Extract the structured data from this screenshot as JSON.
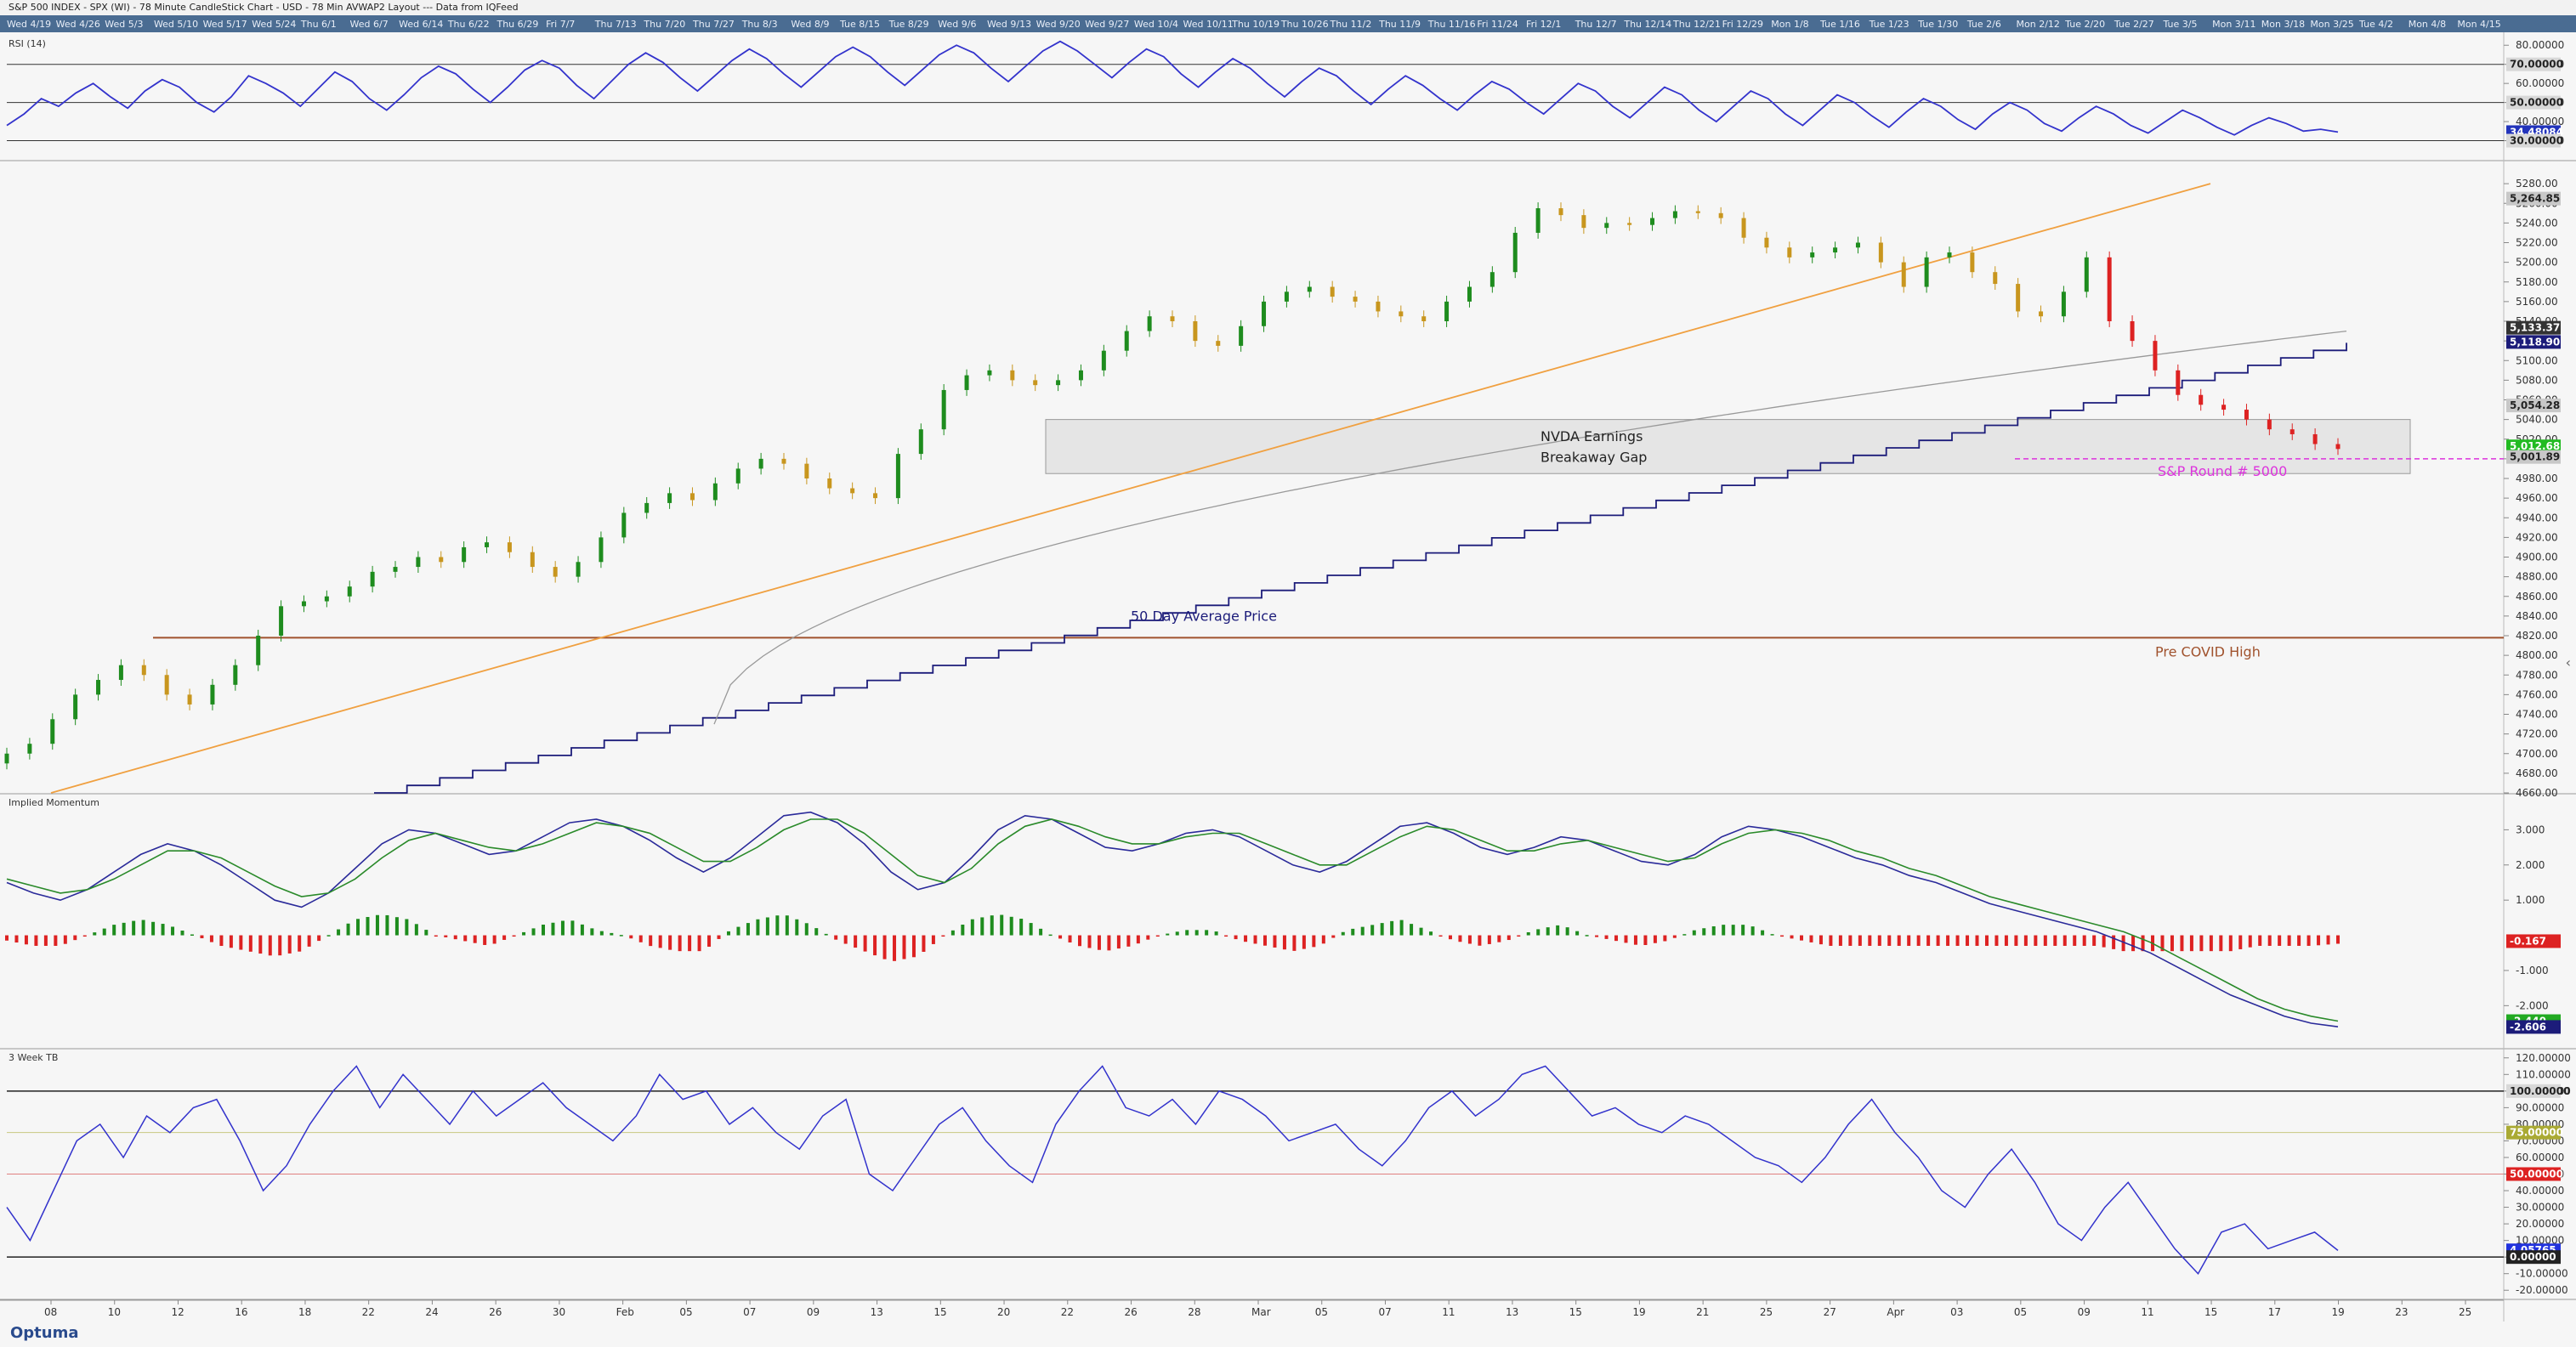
{
  "window": {
    "title": "S&P 500 INDEX - SPX (WI) - 78 Minute CandleStick Chart - USD - 78 Min AVWAP2 Layout --- Data from IQFeed"
  },
  "date_strip": [
    "Wed 4/19",
    "Wed 4/26",
    "Wed 5/3",
    "Wed 5/10",
    "Wed 5/17",
    "Wed 5/24",
    "Thu 6/1",
    "Wed 6/7",
    "Wed 6/14",
    "Thu 6/22",
    "Thu 6/29",
    "Fri 7/7",
    "Thu 7/13",
    "Thu 7/20",
    "Thu 7/27",
    "Thu 8/3",
    "Wed 8/9",
    "Tue 8/15",
    "Tue 8/29",
    "Wed 9/6",
    "Wed 9/13",
    "Wed 9/20",
    "Wed 9/27",
    "Wed 10/4",
    "Wed 10/11",
    "Thu 10/19",
    "Thu 10/26",
    "Thu 11/2",
    "Thu 11/9",
    "Thu 11/16",
    "Fri 11/24",
    "Fri 12/1",
    "Thu 12/7",
    "Thu 12/14",
    "Thu 12/21",
    "Fri 12/29",
    "Mon 1/8",
    "Tue 1/16",
    "Tue 1/23",
    "Tue 1/30",
    "Tue 2/6",
    "Mon 2/12",
    "Tue 2/20",
    "Tue 2/27",
    "Tue 3/5",
    "Mon 3/11",
    "Mon 3/18",
    "Mon 3/25",
    "Tue 4/2",
    "Mon 4/8",
    "Mon 4/15"
  ],
  "footer": {
    "logo": "Optuma"
  },
  "colors": {
    "up_candle": "#1e8c1e",
    "down_candle": "#c8961e",
    "red_candle": "#dd2222",
    "rsi_line": "#3333cc",
    "vwap_line": "#1c1c7a",
    "trendline": "#f0a040",
    "pre_covid_line": "#a0522d",
    "round_5000": "#dd33dd"
  },
  "chart_data": [
    {
      "type": "line",
      "name_label": "RSI (14)",
      "ylim": [
        20,
        85
      ],
      "y_ticks": [
        30,
        40,
        50,
        60,
        70,
        80
      ],
      "y_tick_labels": [
        "30.00000",
        "40.00000",
        "50.00000",
        "60.00000",
        "70.00000",
        "80.00000"
      ],
      "reference_lines": [
        30,
        50,
        70
      ],
      "badges": [
        {
          "label": "70.00000",
          "value": 70,
          "bg": "#d8d8d8",
          "fg": "#222"
        },
        {
          "label": "50.00000",
          "value": 50,
          "bg": "#d8d8d8",
          "fg": "#222"
        },
        {
          "label": "34.48084",
          "value": 34.48,
          "bg": "#2233bb",
          "fg": "#fff"
        },
        {
          "label": "30.00000",
          "value": 30,
          "bg": "#d8d8d8",
          "fg": "#222"
        }
      ],
      "values": [
        38,
        44,
        52,
        48,
        55,
        60,
        53,
        47,
        56,
        62,
        58,
        50,
        45,
        53,
        64,
        60,
        55,
        48,
        57,
        66,
        61,
        52,
        46,
        54,
        63,
        69,
        65,
        57,
        50,
        58,
        67,
        72,
        68,
        59,
        52,
        61,
        70,
        76,
        71,
        63,
        56,
        64,
        72,
        78,
        73,
        65,
        58,
        66,
        74,
        79,
        74,
        66,
        59,
        67,
        75,
        80,
        76,
        68,
        61,
        69,
        77,
        82,
        77,
        70,
        63,
        71,
        78,
        74,
        65,
        58,
        66,
        73,
        68,
        60,
        53,
        61,
        68,
        64,
        56,
        49,
        57,
        64,
        59,
        52,
        46,
        54,
        61,
        57,
        50,
        44,
        52,
        60,
        56,
        48,
        42,
        50,
        58,
        54,
        46,
        40,
        48,
        56,
        52,
        44,
        38,
        46,
        54,
        50,
        43,
        37,
        45,
        52,
        48,
        41,
        36,
        44,
        50,
        46,
        39,
        35,
        42,
        48,
        44,
        38,
        34,
        40,
        46,
        42,
        37,
        33,
        38,
        42,
        39,
        35,
        36,
        34.5
      ]
    },
    {
      "type": "candlestick",
      "ylim": [
        4660,
        5300
      ],
      "y_ticks": [
        4660,
        4680,
        4700,
        4720,
        4740,
        4760,
        4780,
        4800,
        4820,
        4840,
        4860,
        4880,
        4900,
        4920,
        4940,
        4960,
        4980,
        5000,
        5020,
        5040,
        5060,
        5080,
        5100,
        5120,
        5140,
        5160,
        5180,
        5200,
        5220,
        5240,
        5260,
        5280
      ],
      "x_labels": [
        "08",
        "10",
        "12",
        "16",
        "18",
        "22",
        "24",
        "26",
        "30",
        "Feb",
        "05",
        "07",
        "09",
        "13",
        "15",
        "20",
        "22",
        "26",
        "28",
        "Mar",
        "05",
        "07",
        "11",
        "13",
        "15",
        "19",
        "21",
        "25",
        "27",
        "Apr",
        "03",
        "05",
        "09",
        "11",
        "15",
        "17",
        "19",
        "23",
        "25"
      ],
      "close": [
        4700,
        4710,
        4735,
        4760,
        4775,
        4790,
        4780,
        4760,
        4750,
        4770,
        4790,
        4820,
        4850,
        4855,
        4860,
        4870,
        4885,
        4890,
        4900,
        4895,
        4910,
        4915,
        4905,
        4890,
        4880,
        4895,
        4920,
        4945,
        4955,
        4965,
        4958,
        4975,
        4990,
        5000,
        4995,
        4980,
        4970,
        4965,
        4960,
        5005,
        5030,
        5070,
        5085,
        5090,
        5080,
        5075,
        5080,
        5090,
        5110,
        5130,
        5145,
        5140,
        5120,
        5115,
        5135,
        5160,
        5170,
        5175,
        5165,
        5160,
        5150,
        5145,
        5140,
        5160,
        5175,
        5190,
        5230,
        5255,
        5248,
        5235,
        5240,
        5238,
        5245,
        5252,
        5250,
        5245,
        5225,
        5215,
        5205,
        5210,
        5215,
        5220,
        5200,
        5175,
        5205,
        5210,
        5190,
        5178,
        5150,
        5145,
        5170,
        5205,
        5140,
        5120,
        5090,
        5065,
        5055,
        5050,
        5040,
        5030,
        5025,
        5015,
        5010
      ],
      "annotations": [
        {
          "text": "NVDA Earnings",
          "line": 1
        },
        {
          "text": "Breakaway Gap",
          "line": 2
        },
        {
          "text": "S&P Round # 5000"
        },
        {
          "text": "50 Day Average Price"
        },
        {
          "text": "Pre COVID High"
        }
      ],
      "levels": {
        "pre_covid_high": 4818,
        "round_5000": 5000,
        "gap_top": 5040,
        "gap_bottom": 4985
      },
      "badges": [
        {
          "label": "5,264.85",
          "value": 5264.85,
          "bg": "#c8c8c8",
          "fg": "#222"
        },
        {
          "label": "5,133.37",
          "value": 5133.37,
          "bg": "#333",
          "fg": "#fff"
        },
        {
          "label": "5,118.90",
          "value": 5118.9,
          "bg": "#1c1c7a",
          "fg": "#fff"
        },
        {
          "label": "5,054.28",
          "value": 5054.28,
          "bg": "#c8c8c8",
          "fg": "#222"
        },
        {
          "label": "5,012.68",
          "value": 5012.68,
          "bg": "#22bb22",
          "fg": "#fff"
        },
        {
          "label": "5,001.89",
          "value": 5001.89,
          "bg": "#c8c8c8",
          "fg": "#222"
        }
      ]
    },
    {
      "type": "line",
      "name_label": "Implied Momentum",
      "ylim": [
        -3.2,
        4.0
      ],
      "y_ticks": [
        3.0,
        2.0,
        1.0,
        -1.0,
        -2.0
      ],
      "y_tick_labels": [
        "3.000",
        "2.000",
        "1.000",
        "-1.000",
        "-2.000"
      ],
      "badges": [
        {
          "label": "-0.167",
          "value": -0.167,
          "bg": "#dd2222",
          "fg": "#fff"
        },
        {
          "label": "-2.440",
          "value": -2.44,
          "bg": "#22aa22",
          "fg": "#fff"
        },
        {
          "label": "-2.606",
          "value": -2.606,
          "bg": "#1c1c7a",
          "fg": "#fff"
        }
      ],
      "series": [
        {
          "color": "#2a2a9a",
          "values": [
            1.5,
            1.2,
            1.0,
            1.3,
            1.8,
            2.3,
            2.6,
            2.4,
            2.0,
            1.5,
            1.0,
            0.8,
            1.2,
            1.9,
            2.6,
            3.0,
            2.9,
            2.6,
            2.3,
            2.4,
            2.8,
            3.2,
            3.3,
            3.1,
            2.7,
            2.2,
            1.8,
            2.2,
            2.8,
            3.4,
            3.5,
            3.2,
            2.6,
            1.8,
            1.3,
            1.5,
            2.2,
            3.0,
            3.4,
            3.3,
            2.9,
            2.5,
            2.4,
            2.6,
            2.9,
            3.0,
            2.8,
            2.4,
            2.0,
            1.8,
            2.1,
            2.6,
            3.1,
            3.2,
            2.9,
            2.5,
            2.3,
            2.5,
            2.8,
            2.7,
            2.4,
            2.1,
            2.0,
            2.3,
            2.8,
            3.1,
            3.0,
            2.8,
            2.5,
            2.2,
            2.0,
            1.7,
            1.5,
            1.2,
            0.9,
            0.7,
            0.5,
            0.3,
            0.1,
            -0.2,
            -0.5,
            -0.9,
            -1.3,
            -1.7,
            -2.0,
            -2.3,
            -2.5,
            -2.6
          ]
        },
        {
          "color": "#2a8a2a",
          "values": [
            1.6,
            1.4,
            1.2,
            1.3,
            1.6,
            2.0,
            2.4,
            2.4,
            2.2,
            1.8,
            1.4,
            1.1,
            1.2,
            1.6,
            2.2,
            2.7,
            2.9,
            2.7,
            2.5,
            2.4,
            2.6,
            2.9,
            3.2,
            3.1,
            2.9,
            2.5,
            2.1,
            2.1,
            2.5,
            3.0,
            3.3,
            3.3,
            2.9,
            2.3,
            1.7,
            1.5,
            1.9,
            2.6,
            3.1,
            3.3,
            3.1,
            2.8,
            2.6,
            2.6,
            2.8,
            2.9,
            2.9,
            2.6,
            2.3,
            2.0,
            2.0,
            2.4,
            2.8,
            3.1,
            3.0,
            2.7,
            2.4,
            2.4,
            2.6,
            2.7,
            2.5,
            2.3,
            2.1,
            2.2,
            2.6,
            2.9,
            3.0,
            2.9,
            2.7,
            2.4,
            2.2,
            1.9,
            1.7,
            1.4,
            1.1,
            0.9,
            0.7,
            0.5,
            0.3,
            0.1,
            -0.2,
            -0.6,
            -1.0,
            -1.4,
            -1.8,
            -2.1,
            -2.3,
            -2.44
          ]
        }
      ]
    },
    {
      "type": "line",
      "name_label": "3 Week TB",
      "ylim": [
        -25,
        125
      ],
      "y_ticks": [
        120,
        110,
        100,
        90,
        80,
        70,
        60,
        50,
        40,
        30,
        20,
        10,
        0,
        -10,
        -20
      ],
      "y_tick_labels": [
        "120.00000",
        "110.00000",
        "100.00000",
        "90.00000",
        "80.00000",
        "70.00000",
        "60.00000",
        "50.00000",
        "40.00000",
        "30.00000",
        "20.00000",
        "10.00000",
        "0.00000",
        "-10.00000",
        "-20.00000"
      ],
      "reference_lines": [
        0,
        50,
        75,
        100
      ],
      "badges": [
        {
          "label": "100.00000",
          "value": 100,
          "bg": "#d8d8d8",
          "fg": "#222"
        },
        {
          "label": "75.00000",
          "value": 75,
          "bg": "#aaaa33",
          "fg": "#fff"
        },
        {
          "label": "50.00000",
          "value": 50,
          "bg": "#dd2222",
          "fg": "#fff"
        },
        {
          "label": "4.05765",
          "value": 4.06,
          "bg": "#2233dd",
          "fg": "#fff"
        },
        {
          "label": "0.00000",
          "value": 0,
          "bg": "#222",
          "fg": "#fff"
        }
      ],
      "values": [
        30,
        10,
        40,
        70,
        80,
        60,
        85,
        75,
        90,
        95,
        70,
        40,
        55,
        80,
        100,
        115,
        90,
        110,
        95,
        80,
        100,
        85,
        95,
        105,
        90,
        80,
        70,
        85,
        110,
        95,
        100,
        80,
        90,
        75,
        65,
        85,
        95,
        50,
        40,
        60,
        80,
        90,
        70,
        55,
        45,
        80,
        100,
        115,
        90,
        85,
        95,
        80,
        100,
        95,
        85,
        70,
        75,
        80,
        65,
        55,
        70,
        90,
        100,
        85,
        95,
        110,
        115,
        100,
        85,
        90,
        80,
        75,
        85,
        80,
        70,
        60,
        55,
        45,
        60,
        80,
        95,
        75,
        60,
        40,
        30,
        50,
        65,
        45,
        20,
        10,
        30,
        45,
        25,
        5,
        -10,
        15,
        20,
        5,
        10,
        15,
        4
      ]
    }
  ]
}
